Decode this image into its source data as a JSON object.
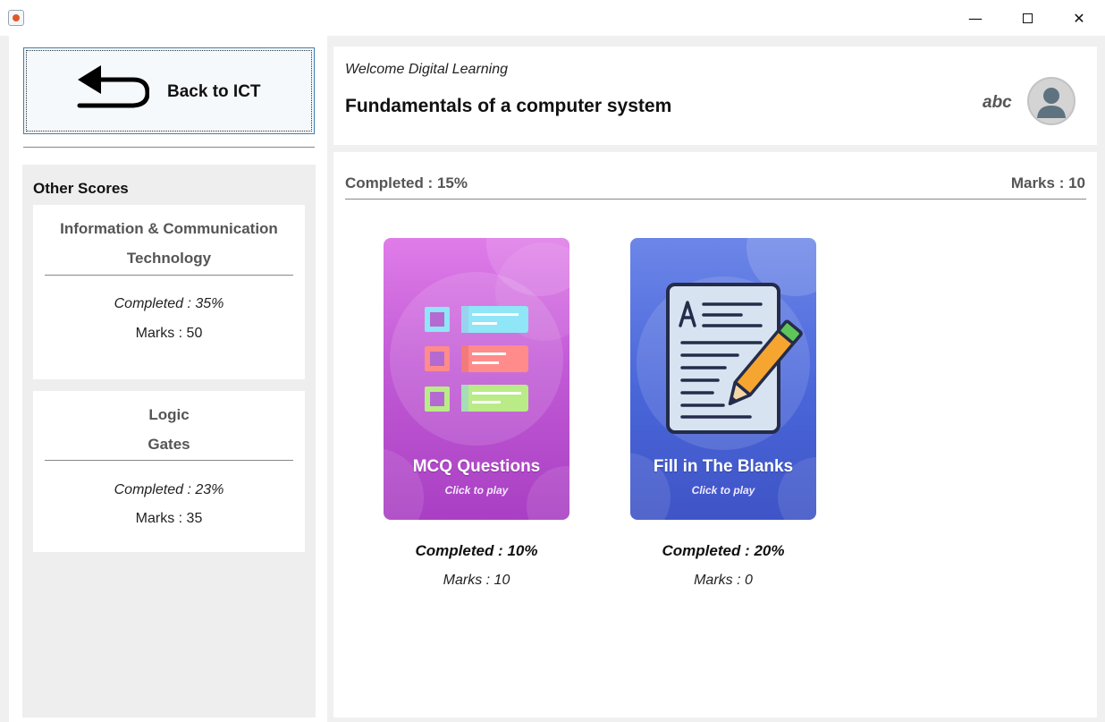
{
  "window": {
    "minimize_symbol": "—",
    "close_symbol": "✕"
  },
  "sidebar": {
    "back_button_label": "Back to ICT",
    "other_scores_title": "Other Scores",
    "scores": [
      {
        "name_line1": "Information & Communication",
        "name_line2": "Technology",
        "completed": "Completed : 35%",
        "marks": "Marks : 50"
      },
      {
        "name_line1": "Logic",
        "name_line2": "Gates",
        "completed": "Completed : 23%",
        "marks": "Marks : 35"
      }
    ]
  },
  "header": {
    "welcome": "Welcome Digital Learning",
    "title": "Fundamentals of a computer  system",
    "username": "abc"
  },
  "main": {
    "completed": "Completed : 15%",
    "marks": "Marks : 10",
    "games": [
      {
        "title": "MCQ Questions",
        "subtitle": "Click to play",
        "completed": "Completed : 10%",
        "marks": "Marks : 10",
        "icon": "checklist-icon",
        "color": "#c25bd6"
      },
      {
        "title": "Fill in The Blanks",
        "subtitle": "Click to play",
        "completed": "Completed : 20%",
        "marks": "Marks : 0",
        "icon": "document-pencil-icon",
        "color": "#4966d9"
      }
    ]
  },
  "icons": {
    "app": "java-app-icon",
    "back": "back-arrow-icon",
    "avatar": "user-avatar-icon"
  }
}
